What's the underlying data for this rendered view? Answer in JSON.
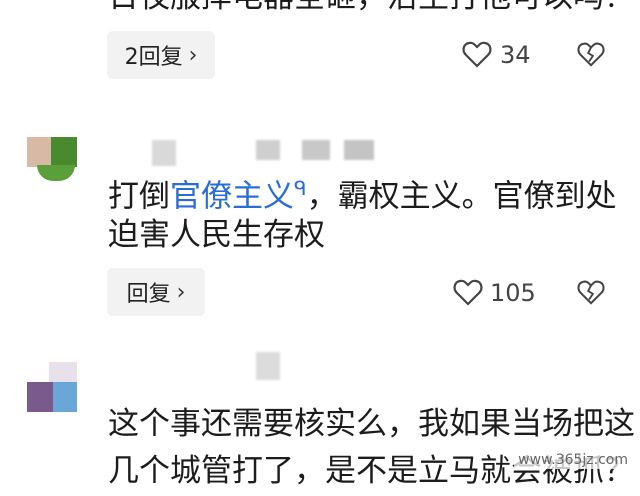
{
  "comment1": {
    "text_clipped": "日夜服摔电器全砸，治主打他可以吗？",
    "reply_label": "2回复",
    "likes": "34"
  },
  "comment2": {
    "text_part1": "打倒",
    "link_text": "官僚主义",
    "text_part2": "，霸权主义。官僚到处",
    "text_line2": "迫害人民生存权",
    "reply_label": "回复",
    "likes": "105"
  },
  "comment3": {
    "line1": "这个事还需要核实么，我如果当场把这",
    "line2": "几个城管打了，是不是立马就会被抓？"
  },
  "watermark": {
    "text": "www.365jz.com"
  },
  "colors": {
    "link": "#2a6dd9",
    "reply_bg": "#f2f2f2"
  }
}
